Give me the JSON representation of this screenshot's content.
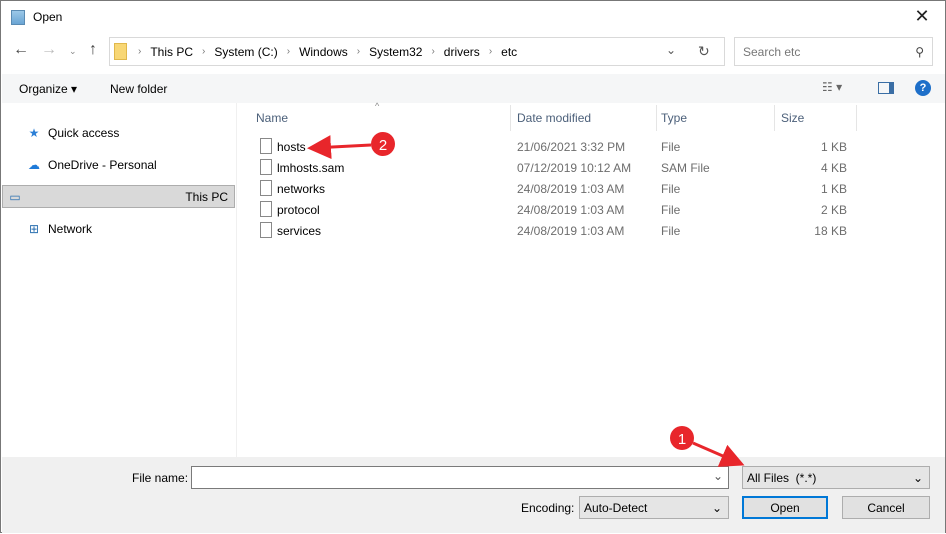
{
  "window": {
    "title": "Open",
    "close": "✕"
  },
  "address": {
    "crumbs": [
      "This PC",
      "System (C:)",
      "Windows",
      "System32",
      "drivers",
      "etc"
    ]
  },
  "search": {
    "placeholder": "Search etc"
  },
  "toolbar": {
    "organize": "Organize ▾",
    "new_folder": "New folder"
  },
  "sidebar": {
    "items": [
      {
        "label": "Quick access",
        "icon": "star-icon"
      },
      {
        "label": "OneDrive - Personal",
        "icon": "cloud-icon"
      },
      {
        "label": "This PC",
        "icon": "computer-icon",
        "selected": true
      },
      {
        "label": "Network",
        "icon": "network-icon"
      }
    ]
  },
  "columns": [
    "Name",
    "Date modified",
    "Type",
    "Size"
  ],
  "files": [
    {
      "name": "hosts",
      "date": "21/06/2021 3:32 PM",
      "type": "File",
      "size": "1 KB"
    },
    {
      "name": "lmhosts.sam",
      "date": "07/12/2019 10:12 AM",
      "type": "SAM File",
      "size": "4 KB"
    },
    {
      "name": "networks",
      "date": "24/08/2019 1:03 AM",
      "type": "File",
      "size": "1 KB"
    },
    {
      "name": "protocol",
      "date": "24/08/2019 1:03 AM",
      "type": "File",
      "size": "2 KB"
    },
    {
      "name": "services",
      "date": "24/08/2019 1:03 AM",
      "type": "File",
      "size": "18 KB"
    }
  ],
  "bottom": {
    "file_name_label": "File name:",
    "file_name_value": "",
    "filter": "All Files  (*.*)",
    "encoding_label": "Encoding:",
    "encoding": "Auto-Detect",
    "open": "Open",
    "cancel": "Cancel"
  },
  "annotations": {
    "one": "1",
    "two": "2",
    "color": "#e8262b"
  }
}
